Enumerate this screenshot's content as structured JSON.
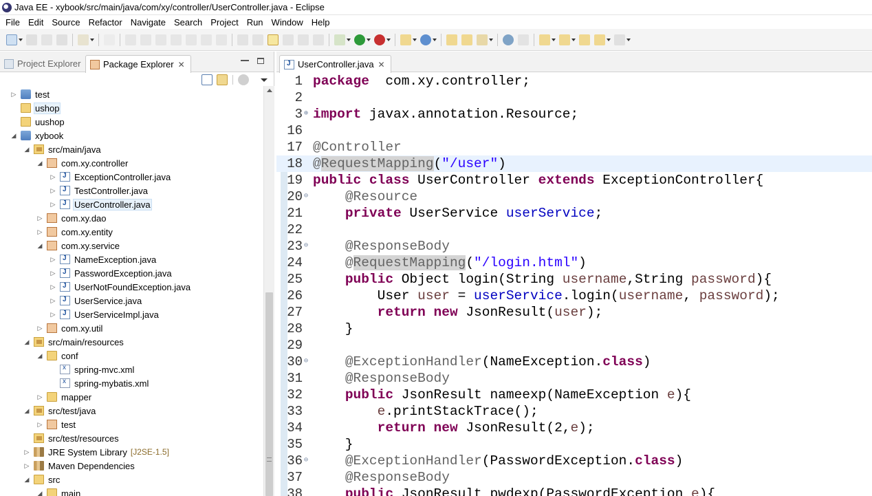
{
  "window": {
    "title": "Java EE - xybook/src/main/java/com/xy/controller/UserController.java - Eclipse"
  },
  "menu": [
    "File",
    "Edit",
    "Source",
    "Refactor",
    "Navigate",
    "Search",
    "Project",
    "Run",
    "Window",
    "Help"
  ],
  "left_panel": {
    "tabs": [
      {
        "label": "Project Explorer",
        "active": false
      },
      {
        "label": "Package Explorer",
        "active": true
      }
    ],
    "tree": [
      {
        "label": "test",
        "depth": 0,
        "twisty": "closed",
        "icon": "project-icon"
      },
      {
        "label": "ushop",
        "depth": 0,
        "twisty": "none",
        "icon": "folder-icon",
        "selected": true
      },
      {
        "label": "uushop",
        "depth": 0,
        "twisty": "none",
        "icon": "folder-icon"
      },
      {
        "label": "xybook",
        "depth": 0,
        "twisty": "open",
        "icon": "project-icon"
      },
      {
        "label": "src/main/java",
        "depth": 1,
        "twisty": "open",
        "icon": "source-folder-icon"
      },
      {
        "label": "com.xy.controller",
        "depth": 2,
        "twisty": "open",
        "icon": "package-icon"
      },
      {
        "label": "ExceptionController.java",
        "depth": 3,
        "twisty": "closed",
        "icon": "java-file-icon"
      },
      {
        "label": "TestController.java",
        "depth": 3,
        "twisty": "closed",
        "icon": "java-file-icon"
      },
      {
        "label": "UserController.java",
        "depth": 3,
        "twisty": "closed",
        "icon": "java-file-icon",
        "selected": true
      },
      {
        "label": "com.xy.dao",
        "depth": 2,
        "twisty": "closed",
        "icon": "package-icon"
      },
      {
        "label": "com.xy.entity",
        "depth": 2,
        "twisty": "closed",
        "icon": "package-icon"
      },
      {
        "label": "com.xy.service",
        "depth": 2,
        "twisty": "open",
        "icon": "package-icon"
      },
      {
        "label": "NameException.java",
        "depth": 3,
        "twisty": "closed",
        "icon": "java-file-icon"
      },
      {
        "label": "PasswordException.java",
        "depth": 3,
        "twisty": "closed",
        "icon": "java-file-icon"
      },
      {
        "label": "UserNotFoundException.java",
        "depth": 3,
        "twisty": "closed",
        "icon": "java-file-icon"
      },
      {
        "label": "UserService.java",
        "depth": 3,
        "twisty": "closed",
        "icon": "java-file-icon"
      },
      {
        "label": "UserServiceImpl.java",
        "depth": 3,
        "twisty": "closed",
        "icon": "java-file-icon"
      },
      {
        "label": "com.xy.util",
        "depth": 2,
        "twisty": "closed",
        "icon": "package-icon"
      },
      {
        "label": "src/main/resources",
        "depth": 1,
        "twisty": "open",
        "icon": "source-folder-icon"
      },
      {
        "label": "conf",
        "depth": 2,
        "twisty": "open",
        "icon": "folder-icon"
      },
      {
        "label": "spring-mvc.xml",
        "depth": 3,
        "twisty": "none",
        "icon": "xml-file-icon"
      },
      {
        "label": "spring-mybatis.xml",
        "depth": 3,
        "twisty": "none",
        "icon": "xml-file-icon"
      },
      {
        "label": "mapper",
        "depth": 2,
        "twisty": "closed",
        "icon": "folder-icon"
      },
      {
        "label": "src/test/java",
        "depth": 1,
        "twisty": "open",
        "icon": "source-folder-icon"
      },
      {
        "label": "test",
        "depth": 2,
        "twisty": "closed",
        "icon": "package-icon"
      },
      {
        "label": "src/test/resources",
        "depth": 1,
        "twisty": "none",
        "icon": "source-folder-icon"
      },
      {
        "label": "JRE System Library",
        "decoration": "[J2SE-1.5]",
        "depth": 1,
        "twisty": "closed",
        "icon": "library-icon"
      },
      {
        "label": "Maven Dependencies",
        "depth": 1,
        "twisty": "closed",
        "icon": "library-icon"
      },
      {
        "label": "src",
        "depth": 1,
        "twisty": "open",
        "icon": "folder-icon"
      },
      {
        "label": "main",
        "depth": 2,
        "twisty": "open",
        "icon": "folder-icon"
      }
    ]
  },
  "editor": {
    "tab": {
      "label": "UserController.java"
    },
    "lines": [
      {
        "n": "1",
        "fold": "",
        "hl": false,
        "tokens": [
          [
            "kw",
            "package"
          ],
          [
            "",
            "  com.xy.controller;"
          ]
        ]
      },
      {
        "n": "2",
        "fold": "",
        "hl": false,
        "tokens": []
      },
      {
        "n": "3",
        "fold": "plus",
        "hl": false,
        "tokens": [
          [
            "kw",
            "import"
          ],
          [
            "",
            " javax.annotation.Resource;"
          ]
        ]
      },
      {
        "n": "16",
        "fold": "",
        "hl": false,
        "tokens": []
      },
      {
        "n": "17",
        "fold": "",
        "hl": false,
        "tokens": [
          [
            "an",
            "@Controller"
          ]
        ]
      },
      {
        "n": "18",
        "fold": "",
        "hl": true,
        "tokens": [
          [
            "an",
            "@"
          ],
          [
            "an occ",
            "RequestMapping"
          ],
          [
            "",
            "("
          ],
          [
            "st",
            "\"/user\""
          ],
          [
            "",
            ")"
          ]
        ]
      },
      {
        "n": "19",
        "fold": "",
        "hl": false,
        "tokens": [
          [
            "kw",
            "public"
          ],
          [
            "",
            " "
          ],
          [
            "kw",
            "class"
          ],
          [
            "",
            " UserController "
          ],
          [
            "kw",
            "extends"
          ],
          [
            "",
            " ExceptionController{"
          ]
        ]
      },
      {
        "n": "20",
        "fold": "minus",
        "hl": false,
        "tokens": [
          [
            "",
            "    "
          ],
          [
            "an",
            "@Resource"
          ]
        ]
      },
      {
        "n": "21",
        "fold": "",
        "hl": false,
        "tokens": [
          [
            "",
            "    "
          ],
          [
            "kw",
            "private"
          ],
          [
            "",
            " UserService "
          ],
          [
            "fd",
            "userService"
          ],
          [
            "",
            ";"
          ]
        ]
      },
      {
        "n": "22",
        "fold": "",
        "hl": false,
        "tokens": []
      },
      {
        "n": "23",
        "fold": "minus",
        "hl": false,
        "tokens": [
          [
            "",
            "    "
          ],
          [
            "an",
            "@ResponseBody"
          ]
        ]
      },
      {
        "n": "24",
        "fold": "",
        "hl": false,
        "tokens": [
          [
            "",
            "    "
          ],
          [
            "an",
            "@"
          ],
          [
            "an occ",
            "RequestMapping"
          ],
          [
            "",
            "("
          ],
          [
            "st",
            "\"/login.html\""
          ],
          [
            "",
            ")"
          ]
        ]
      },
      {
        "n": "25",
        "fold": "",
        "hl": false,
        "tokens": [
          [
            "",
            "    "
          ],
          [
            "kw",
            "public"
          ],
          [
            "",
            " Object login(String "
          ],
          [
            "lv",
            "username"
          ],
          [
            "",
            ",String "
          ],
          [
            "lv",
            "password"
          ],
          [
            "",
            "){"
          ]
        ]
      },
      {
        "n": "26",
        "fold": "",
        "hl": false,
        "tokens": [
          [
            "",
            "        User "
          ],
          [
            "lv",
            "user"
          ],
          [
            "",
            " = "
          ],
          [
            "fd",
            "userService"
          ],
          [
            "",
            ".login("
          ],
          [
            "lv",
            "username"
          ],
          [
            "",
            ", "
          ],
          [
            "lv",
            "password"
          ],
          [
            "",
            ");"
          ]
        ]
      },
      {
        "n": "27",
        "fold": "",
        "hl": false,
        "tokens": [
          [
            "",
            "        "
          ],
          [
            "kw",
            "return"
          ],
          [
            "",
            " "
          ],
          [
            "kw",
            "new"
          ],
          [
            "",
            " JsonResult("
          ],
          [
            "lv",
            "user"
          ],
          [
            "",
            ");"
          ]
        ]
      },
      {
        "n": "28",
        "fold": "",
        "hl": false,
        "tokens": [
          [
            "",
            "    }"
          ]
        ]
      },
      {
        "n": "29",
        "fold": "",
        "hl": false,
        "tokens": []
      },
      {
        "n": "30",
        "fold": "minus",
        "hl": false,
        "tokens": [
          [
            "",
            "    "
          ],
          [
            "an",
            "@ExceptionHandler"
          ],
          [
            "",
            "(NameException."
          ],
          [
            "kw",
            "class"
          ],
          [
            "",
            ")"
          ]
        ]
      },
      {
        "n": "31",
        "fold": "",
        "hl": false,
        "tokens": [
          [
            "",
            "    "
          ],
          [
            "an",
            "@ResponseBody"
          ]
        ]
      },
      {
        "n": "32",
        "fold": "",
        "hl": false,
        "tokens": [
          [
            "",
            "    "
          ],
          [
            "kw",
            "public"
          ],
          [
            "",
            " JsonResult nameexp(NameException "
          ],
          [
            "lv",
            "e"
          ],
          [
            "",
            "){"
          ]
        ]
      },
      {
        "n": "33",
        "fold": "",
        "hl": false,
        "tokens": [
          [
            "",
            "        "
          ],
          [
            "lv",
            "e"
          ],
          [
            "",
            ".printStackTrace();"
          ]
        ]
      },
      {
        "n": "34",
        "fold": "",
        "hl": false,
        "tokens": [
          [
            "",
            "        "
          ],
          [
            "kw",
            "return"
          ],
          [
            "",
            " "
          ],
          [
            "kw",
            "new"
          ],
          [
            "",
            " JsonResult(2,"
          ],
          [
            "lv",
            "e"
          ],
          [
            "",
            ");"
          ]
        ]
      },
      {
        "n": "35",
        "fold": "",
        "hl": false,
        "tokens": [
          [
            "",
            "    }"
          ]
        ]
      },
      {
        "n": "36",
        "fold": "minus",
        "hl": false,
        "tokens": [
          [
            "",
            "    "
          ],
          [
            "an",
            "@ExceptionHandler"
          ],
          [
            "",
            "(PasswordException."
          ],
          [
            "kw",
            "class"
          ],
          [
            "",
            ")"
          ]
        ]
      },
      {
        "n": "37",
        "fold": "",
        "hl": false,
        "tokens": [
          [
            "",
            "    "
          ],
          [
            "an",
            "@ResponseBody"
          ]
        ]
      },
      {
        "n": "38",
        "fold": "",
        "hl": false,
        "tokens": [
          [
            "",
            "    "
          ],
          [
            "kw",
            "public"
          ],
          [
            "",
            " JsonResult pwdexp(PasswordException "
          ],
          [
            "lv",
            "e"
          ],
          [
            "",
            "){"
          ]
        ]
      }
    ]
  }
}
